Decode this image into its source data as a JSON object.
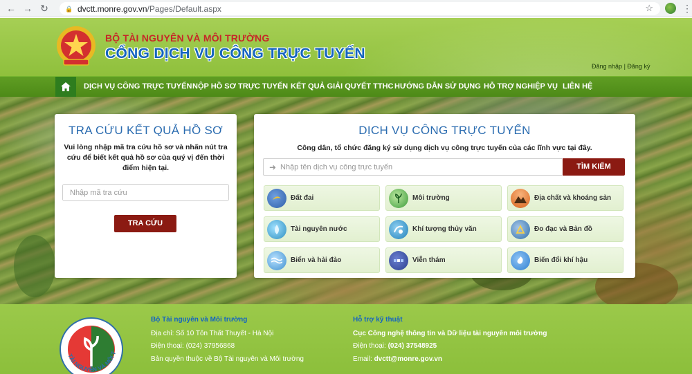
{
  "browser": {
    "url_host": "dvctt.monre.gov.vn",
    "url_path": "/Pages/Default.aspx"
  },
  "header": {
    "ministry": "BỘ TÀI NGUYÊN VÀ MÔI TRƯỜNG",
    "portal": "CỔNG DỊCH VỤ CÔNG TRỰC TUYẾN",
    "login": "Đăng nhập",
    "separator": "|",
    "register": "Đăng ký"
  },
  "nav": {
    "items": [
      "DỊCH VỤ CÔNG TRỰC TUYẾN",
      "NỘP HỒ SƠ TRỰC TUYẾN",
      "KẾT QUẢ GIẢI QUYẾT TTHC",
      "HƯỚNG DẪN SỬ DỤNG",
      "HỖ TRỢ NGHIỆP VỤ",
      "LIÊN HỆ"
    ]
  },
  "lookup": {
    "title": "TRA CỨU KẾT QUẢ HỒ SƠ",
    "description": "Vui lòng nhập mã tra cứu hồ sơ và nhấn nút tra cứu để biết kết quả hồ sơ của quý vị đến thời điểm hiện tại.",
    "placeholder": "Nhập mã tra cứu",
    "button": "TRA CỨU"
  },
  "services": {
    "title": "DỊCH VỤ CÔNG TRỰC TUYẾN",
    "description": "Công dân, tổ chức đăng ký sử dụng dịch vụ công trực tuyến của các lĩnh vực tại đây.",
    "search_placeholder": "Nhập tên dịch vụ công trực tuyến",
    "search_button": "TÌM KIẾM",
    "tiles": [
      {
        "label": "Đất đai",
        "icon": "land-icon",
        "color": "#2f5fa8"
      },
      {
        "label": "Môi trường",
        "icon": "environment-icon",
        "color": "#3a9a3a"
      },
      {
        "label": "Địa chất và khoáng sản",
        "icon": "geology-icon",
        "color": "#d9651f"
      },
      {
        "label": "Tài nguyên nước",
        "icon": "water-icon",
        "color": "#2f8fbf"
      },
      {
        "label": "Khí tượng thủy văn",
        "icon": "meteorology-icon",
        "color": "#1f7fb8"
      },
      {
        "label": "Đo đạc và Bản đồ",
        "icon": "survey-map-icon",
        "color": "#2f6fa8"
      },
      {
        "label": "Biển và hải đảo",
        "icon": "sea-island-icon",
        "color": "#3f8fcf"
      },
      {
        "label": "Viễn thám",
        "icon": "remote-sensing-icon",
        "color": "#2b3f8f"
      },
      {
        "label": "Biến đổi khí hậu",
        "icon": "climate-change-icon",
        "color": "#2f7fd0"
      }
    ]
  },
  "footer": {
    "left": {
      "title": "Bộ Tài nguyên và Môi trường",
      "address": "Địa chỉ: Số 10 Tôn Thất Thuyết - Hà Nội",
      "phone": "Điện thoại: (024) 37956868",
      "copyright": "Bản quyền thuộc về Bộ Tài nguyên và Môi trường"
    },
    "right": {
      "title": "Hỗ trợ kỹ thuật",
      "org": "Cục Công nghệ thông tin và Dữ liệu tài nguyên môi trường",
      "phone_label": "Điện thoại:",
      "phone": "(024) 37548925",
      "email_label": "Email:",
      "email": "dvctt@monre.gov.vn"
    },
    "logo_text": "TÀI NGUYÊN VÀ MÔI TRƯỜNG"
  }
}
